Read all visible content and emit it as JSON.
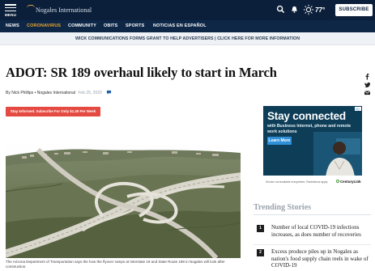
{
  "topbar": {
    "menu_label": "MENU",
    "site_name": "Nogales International",
    "temperature": "77°",
    "subscribe_label": "SUBSCRIBE"
  },
  "nav": {
    "items": [
      {
        "label": "NEWS",
        "active": false
      },
      {
        "label": "CORONAVIRUS",
        "active": true
      },
      {
        "label": "COMMUNITY",
        "active": false
      },
      {
        "label": "OBITS",
        "active": false
      },
      {
        "label": "SPORTS",
        "active": false
      },
      {
        "label": "NOTICIAS EN ESPAÑOL",
        "active": false
      }
    ]
  },
  "announcement": "WICK COMMUNICATIONS FORMS GRANT TO HELP ADVERTISERS | CLICK HERE FOR MORE INFORMATION",
  "article": {
    "headline": "ADOT: SR 189 overhaul likely to start in March",
    "byline": "By Nick Phillips • Nogales International",
    "date": "Feb 25, 2020",
    "subscribe_banner": "Stay Informed. Subscribe For Only $1.29 Per Week",
    "caption": "The Arizona Department of Transportation says the how the flyover ramps at Interstate 19 and State Route 189 in Nogales will look after construction."
  },
  "share_icons": [
    "facebook-icon",
    "twitter-icon",
    "email-icon"
  ],
  "ad": {
    "marker": "D▷",
    "headline": "Stay connected",
    "body": "with Business Internet, phone and remote work solutions",
    "cta": "Learn More",
    "fine_print": "Service not available everywhere. Restrictions apply.",
    "brand": "CenturyLink"
  },
  "trending": {
    "title": "Trending Stories",
    "items": [
      {
        "num": "1",
        "text": "Number of local COVID-19 infections increases, as does number of recoveries"
      },
      {
        "num": "2",
        "text": "Excess produce piles up in Nogales as nation's food supply chain reels in wake of COVID-19"
      }
    ]
  },
  "colors": {
    "topbar": "#0b1f3a",
    "nav_active": "#f0a92b",
    "subscribe_banner": "#e54a42",
    "ad_background": "#0e3d57"
  }
}
